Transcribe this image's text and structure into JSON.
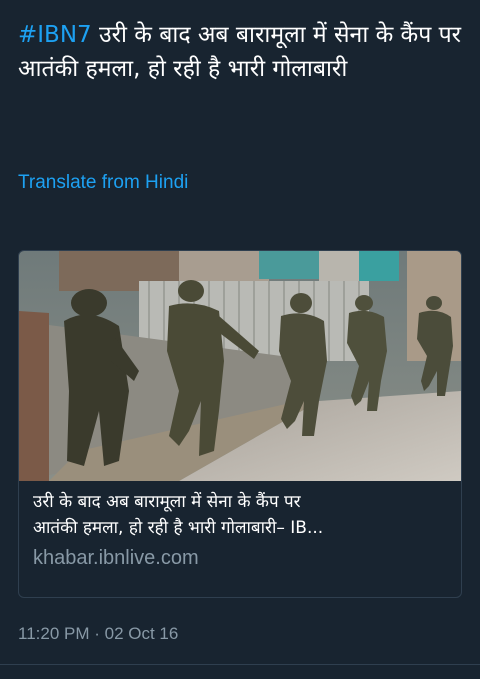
{
  "tweet": {
    "hashtag": "#IBN7",
    "text": " उरी के बाद अब बारामूला में सेना के कैंप पर आतंकी हमला, हो रही है भारी गोलाबारी",
    "translate_label": "Translate from Hindi",
    "timestamp": "11:20 PM · 02 Oct 16"
  },
  "card": {
    "title_line1": "उरी के बाद अब बारामूला में सेना के कैंप पर",
    "title_line2": "आतंकी हमला, हो रही है भारी गोलाबारी– IB...",
    "domain": "khabar.ibnlive.com"
  },
  "colors": {
    "background": "#182430",
    "link": "#1da1f2",
    "muted": "#8899a6",
    "border": "#2f3f4f"
  }
}
